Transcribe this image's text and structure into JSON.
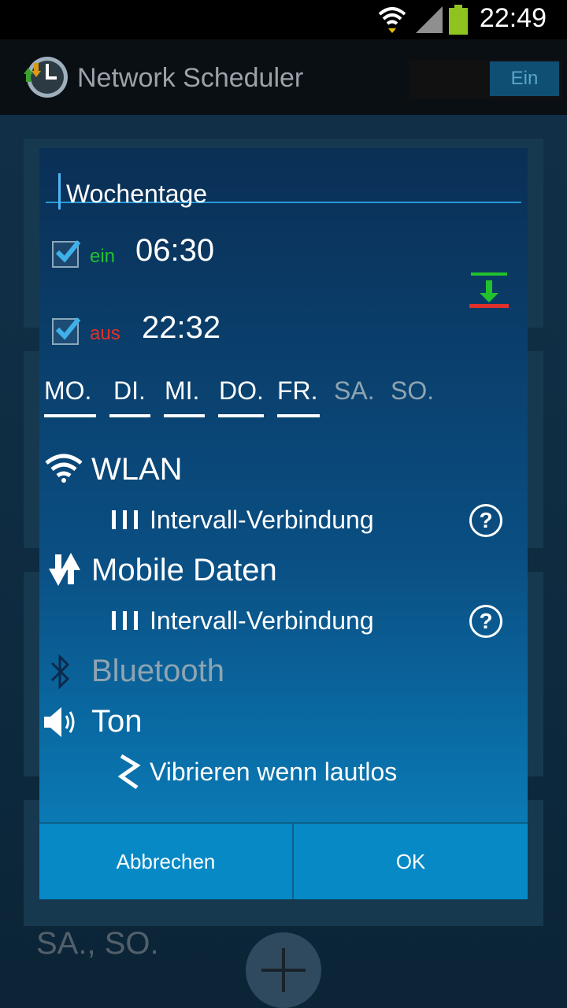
{
  "status_bar": {
    "time": "22:49"
  },
  "action_bar": {
    "title": "Network Scheduler",
    "toggle_label": "Ein"
  },
  "background": {
    "footer_text": "SA., SO."
  },
  "dialog": {
    "title_value": "Wochentage",
    "on_row": {
      "label": "ein",
      "time": "06:30",
      "checked": true
    },
    "off_row": {
      "label": "aus",
      "time": "22:32",
      "checked": true
    },
    "days": [
      {
        "label": "MO.",
        "active": true
      },
      {
        "label": "DI.",
        "active": true
      },
      {
        "label": "MI.",
        "active": true
      },
      {
        "label": "DO.",
        "active": true
      },
      {
        "label": "FR.",
        "active": true
      },
      {
        "label": "SA.",
        "active": false
      },
      {
        "label": "SO.",
        "active": false
      }
    ],
    "features": {
      "wlan": {
        "label": "WLAN",
        "sub": "Intervall-Verbindung"
      },
      "mobile": {
        "label": "Mobile Daten",
        "sub": "Intervall-Verbindung"
      },
      "bluetooth": {
        "label": "Bluetooth"
      },
      "sound": {
        "label": "Ton",
        "sub": "Vibrieren wenn lautlos"
      }
    },
    "help_glyph": "?",
    "cancel_label": "Abbrechen",
    "ok_label": "OK"
  },
  "colors": {
    "on": "#22c12e",
    "off": "#e0312b",
    "accent": "#2a9ad8"
  },
  "icons": [
    "wifi-icon",
    "mobile-data-icon",
    "bluetooth-icon",
    "speaker-icon",
    "vibrate-icon",
    "interval-icon",
    "help-icon",
    "swap-times-icon",
    "app-clock-icon",
    "battery-icon",
    "signal-icon"
  ]
}
